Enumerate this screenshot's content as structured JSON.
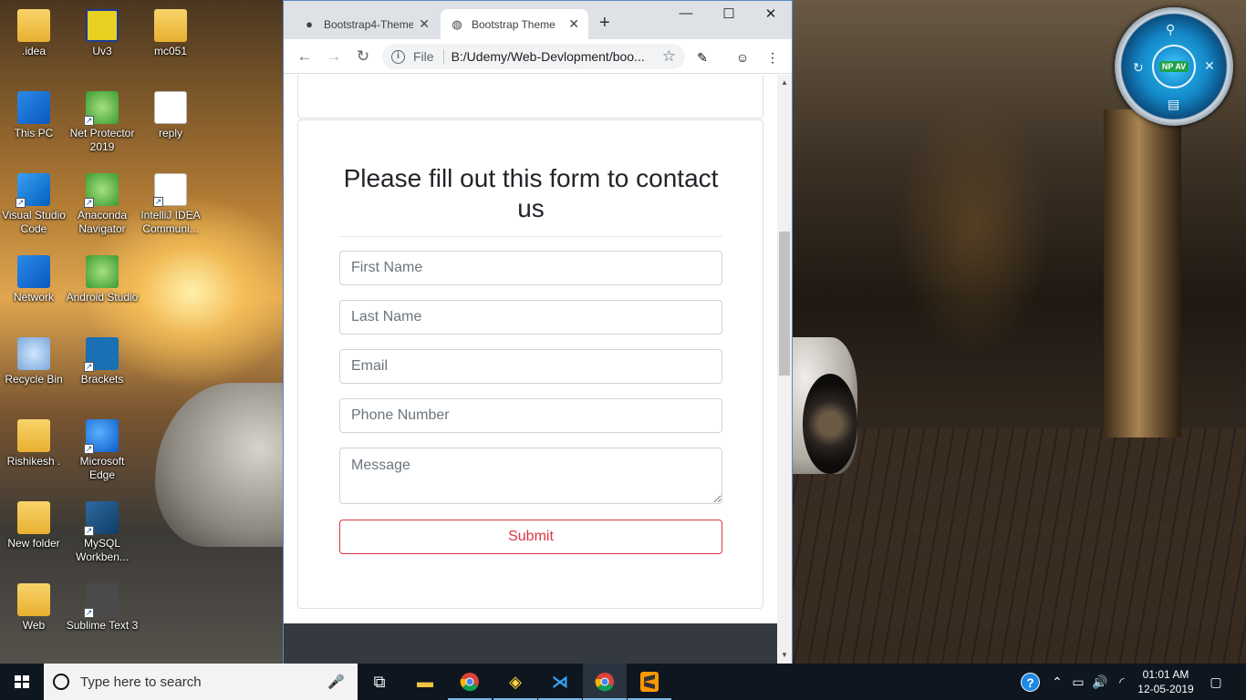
{
  "desktop": {
    "icons": [
      {
        "label": ".idea",
        "icon": "folder-icon"
      },
      {
        "label": "Uv3",
        "icon": "uv3-icon"
      },
      {
        "label": "mc051",
        "icon": "folder-icon"
      },
      {
        "label": "This PC",
        "icon": "computer-icon"
      },
      {
        "label": "Net Protector 2019",
        "icon": "net-protector-icon"
      },
      {
        "label": "reply",
        "icon": "text-file-icon"
      },
      {
        "label": "Visual Studio Code",
        "icon": "vscode-icon"
      },
      {
        "label": "Anaconda Navigator",
        "icon": "anaconda-icon"
      },
      {
        "label": "IntelliJ IDEA Communi...",
        "icon": "intellij-icon"
      },
      {
        "label": "Network",
        "icon": "network-icon"
      },
      {
        "label": "Android Studio",
        "icon": "android-studio-icon"
      },
      {
        "label": "Recycle Bin",
        "icon": "recycle-bin-icon"
      },
      {
        "label": "Brackets",
        "icon": "brackets-icon"
      },
      {
        "label": "Rishikesh .",
        "icon": "user-folder-icon"
      },
      {
        "label": "Microsoft Edge",
        "icon": "edge-icon"
      },
      {
        "label": "New folder",
        "icon": "folder-icon"
      },
      {
        "label": "MySQL Workben...",
        "icon": "mysql-icon"
      },
      {
        "label": "Web",
        "icon": "folder-icon"
      },
      {
        "label": "Sublime Text 3",
        "icon": "sublime-icon"
      }
    ],
    "av_widget": {
      "badge": "NP AV"
    }
  },
  "browser": {
    "tabs": [
      {
        "title": "Bootstrap4-Theme",
        "icon": "github-icon",
        "active": false
      },
      {
        "title": "Bootstrap Theme",
        "icon": "globe-icon",
        "active": true
      }
    ],
    "new_tab": "+",
    "window_controls": {
      "minimize": "—",
      "maximize": "☐",
      "close": "✕"
    },
    "omnibox": {
      "scheme": "File",
      "url": "B:/Udemy/Web-Devlopment/boo..."
    }
  },
  "page": {
    "heading": "Please fill out this form to contact us",
    "form": {
      "first_name_placeholder": "First Name",
      "last_name_placeholder": "Last Name",
      "email_placeholder": "Email",
      "phone_placeholder": "Phone Number",
      "message_placeholder": "Message",
      "submit_label": "Submit"
    },
    "colors": {
      "submit": "#dc3545",
      "footer": "#343a40"
    }
  },
  "taskbar": {
    "search_placeholder": "Type here to search",
    "clock": {
      "time": "01:01 AM",
      "date": "12-05-2019"
    },
    "apps": [
      "task-view-icon",
      "file-explorer-icon",
      "chrome-icon",
      "python-idle-icon",
      "vscode-icon",
      "chrome-icon",
      "sublime-icon"
    ]
  }
}
